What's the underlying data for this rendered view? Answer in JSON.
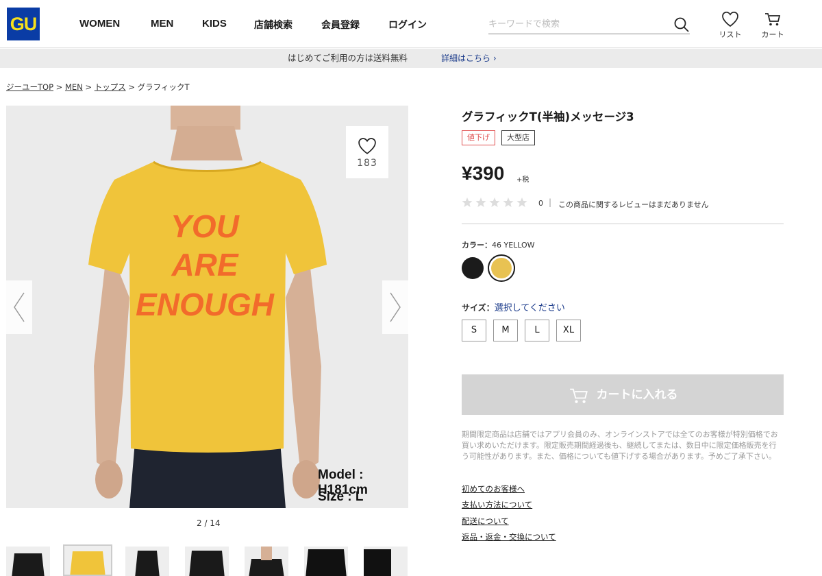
{
  "header": {
    "logo": "GU",
    "nav": [
      "WOMEN",
      "MEN",
      "KIDS",
      "店舗検索",
      "会員登録",
      "ログイン"
    ],
    "search_placeholder": "キーワードで検索",
    "list_label": "リスト",
    "cart_label": "カート"
  },
  "banner": {
    "message": "はじめてご利用の方は送料無料",
    "link": "詳細はこちら ›"
  },
  "breadcrumb": [
    {
      "label": "ジーユーTOP",
      "link": true
    },
    {
      "label": "MEN",
      "link": true
    },
    {
      "label": "トップス",
      "link": true
    },
    {
      "label": "グラフィックT",
      "link": false
    }
  ],
  "gallery": {
    "favorite_count": "183",
    "shirt_text": [
      "YOU",
      "ARE",
      "ENOUGH"
    ],
    "model_line": "Model : H181cm",
    "size_line": "Size : L",
    "pager": "2 / 14",
    "colors": {
      "shirt": "#f0c43a",
      "print": "#f26b2b",
      "bg": "#ebebeb"
    }
  },
  "product": {
    "title": "グラフィックT(半袖)メッセージ3",
    "badges": [
      {
        "label": "値下げ",
        "color": "#e05050"
      },
      {
        "label": "大型店",
        "color": "#333333"
      }
    ],
    "price": "¥390",
    "tax": "+税",
    "rating": 0,
    "review_count": "0",
    "review_text": "この商品に関するレビューはまだありません",
    "color_label": "カラー：",
    "color_value": "46 YELLOW",
    "swatches": [
      {
        "name": "black",
        "hex": "#1b1b1b",
        "selected": false
      },
      {
        "name": "yellow",
        "hex": "#e8c252",
        "selected": true
      }
    ],
    "size_label": "サイズ：",
    "size_prompt": "選択してください",
    "sizes": [
      "S",
      "M",
      "L",
      "XL"
    ],
    "cart_button": "カートに入れる",
    "notice": "期間限定商品は店舗ではアプリ会員のみ、オンラインストアでは全てのお客様が特別価格でお買い求めいただけます。限定販売期間経過後も、継続してまたは、数日中に限定価格販売を行う可能性があります。また、価格についても値下げする場合があります。予めご了承下さい。",
    "links": [
      "初めてのお客様へ",
      "支払い方法について",
      "配送について",
      "返品・返金・交換について"
    ]
  }
}
